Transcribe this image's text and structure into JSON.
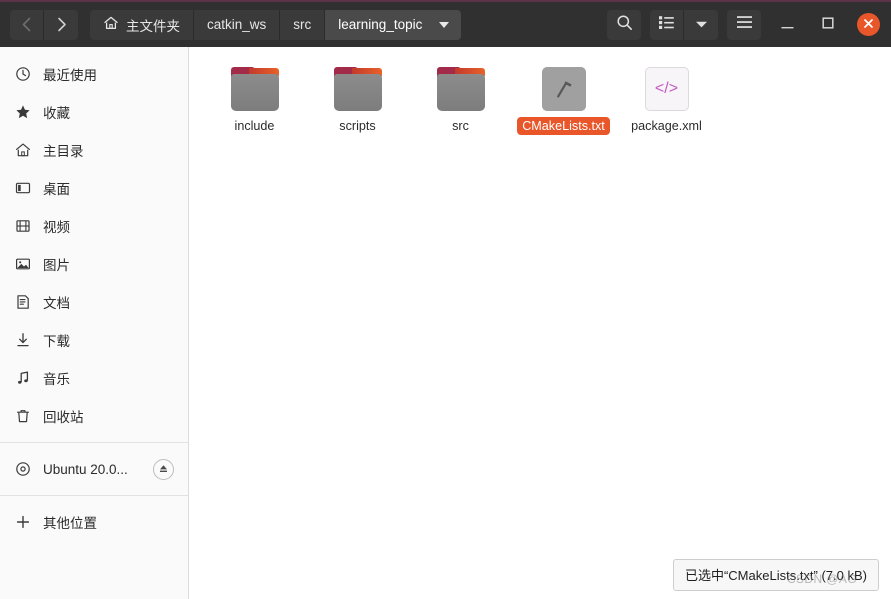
{
  "window": {
    "accent_color": "#e8562a",
    "headerbar_color": "#303030",
    "top_border_color": "#5b3248"
  },
  "header": {
    "nav": {
      "back_label": "‹",
      "forward_label": "›",
      "back_name": "back",
      "forward_name": "forward"
    },
    "breadcrumbs": [
      {
        "label": "主文件夹",
        "icon": "home-icon",
        "active": false
      },
      {
        "label": "catkin_ws",
        "icon": "",
        "active": false
      },
      {
        "label": "src",
        "icon": "",
        "active": false
      },
      {
        "label": "learning_topic",
        "icon": "",
        "active": true
      }
    ],
    "tools": [
      {
        "name": "search-icon",
        "label": ""
      },
      {
        "name": "view-list-icon",
        "label": ""
      },
      {
        "name": "view-options-chevron-down-icon",
        "label": ""
      },
      {
        "name": "main-menu-hamburger-icon",
        "label": ""
      }
    ],
    "window_controls": [
      {
        "name": "minimize-button",
        "label": "—"
      },
      {
        "name": "maximize-button",
        "label": "□"
      },
      {
        "name": "close-button",
        "label": "✕"
      }
    ]
  },
  "sidebar": {
    "items": [
      {
        "label": "最近使用",
        "icon": "clock-icon",
        "name": "sidebar-item-recent"
      },
      {
        "label": "收藏",
        "icon": "star-icon",
        "name": "sidebar-item-starred"
      },
      {
        "label": "主目录",
        "icon": "home-icon",
        "name": "sidebar-item-home"
      },
      {
        "label": "桌面",
        "icon": "desktop-icon",
        "name": "sidebar-item-desktop"
      },
      {
        "label": "视频",
        "icon": "video-icon",
        "name": "sidebar-item-videos"
      },
      {
        "label": "图片",
        "icon": "image-icon",
        "name": "sidebar-item-pictures"
      },
      {
        "label": "文档",
        "icon": "document-icon",
        "name": "sidebar-item-documents"
      },
      {
        "label": "下载",
        "icon": "download-icon",
        "name": "sidebar-item-downloads"
      },
      {
        "label": "音乐",
        "icon": "music-note-icon",
        "name": "sidebar-item-music"
      },
      {
        "label": "回收站",
        "icon": "trash-icon",
        "name": "sidebar-item-trash"
      }
    ],
    "device": {
      "label": "Ubuntu 20.0...",
      "icon": "disc-icon",
      "eject_icon": "eject-icon"
    },
    "other_locations": {
      "label": "其他位置",
      "icon": "plus-icon"
    }
  },
  "files": [
    {
      "name": "include",
      "type": "folder",
      "selected": false,
      "icon": "folder-icon"
    },
    {
      "name": "scripts",
      "type": "folder",
      "selected": false,
      "icon": "folder-icon"
    },
    {
      "name": "src",
      "type": "folder",
      "selected": false,
      "icon": "folder-icon"
    },
    {
      "name": "CMakeLists.txt",
      "type": "file",
      "selected": true,
      "icon": "build-hammer-icon",
      "glyph": "⚒"
    },
    {
      "name": "package.xml",
      "type": "file",
      "selected": false,
      "icon": "code-file-icon",
      "glyph": "</>"
    }
  ],
  "status": {
    "text": "已选中“CMakeLists.txt” (7.0 kB)",
    "watermark": "CSDN @AG"
  }
}
